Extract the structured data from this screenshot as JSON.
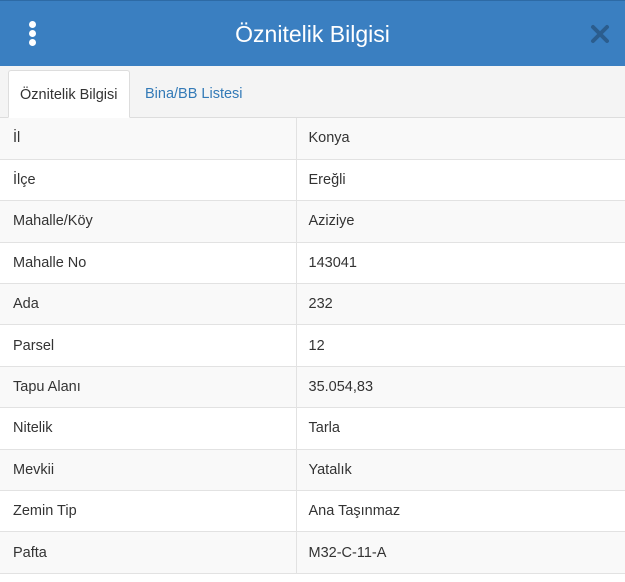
{
  "dialog": {
    "title": "Öznitelik Bilgisi",
    "menu_icon": "vertical-ellipsis-icon",
    "close_icon": "close-x-icon"
  },
  "tabs": [
    {
      "label": "Öznitelik Bilgisi",
      "active": true
    },
    {
      "label": "Bina/BB Listesi",
      "active": false
    }
  ],
  "attributes": [
    {
      "key": "İl",
      "value": "Konya"
    },
    {
      "key": "İlçe",
      "value": "Ereğli"
    },
    {
      "key": "Mahalle/Köy",
      "value": "Aziziye"
    },
    {
      "key": "Mahalle No",
      "value": "143041"
    },
    {
      "key": "Ada",
      "value": "232"
    },
    {
      "key": "Parsel",
      "value": "12"
    },
    {
      "key": "Tapu Alanı",
      "value": "35.054,83"
    },
    {
      "key": "Nitelik",
      "value": "Tarla"
    },
    {
      "key": "Mevkii",
      "value": "Yatalık"
    },
    {
      "key": "Zemin Tip",
      "value": "Ana Taşınmaz"
    },
    {
      "key": "Pafta",
      "value": "M32-C-11-A"
    }
  ],
  "colors": {
    "header": "#3a7fc1",
    "link": "#337ab7",
    "text": "#333333",
    "stripe": "#f9f9f9"
  }
}
